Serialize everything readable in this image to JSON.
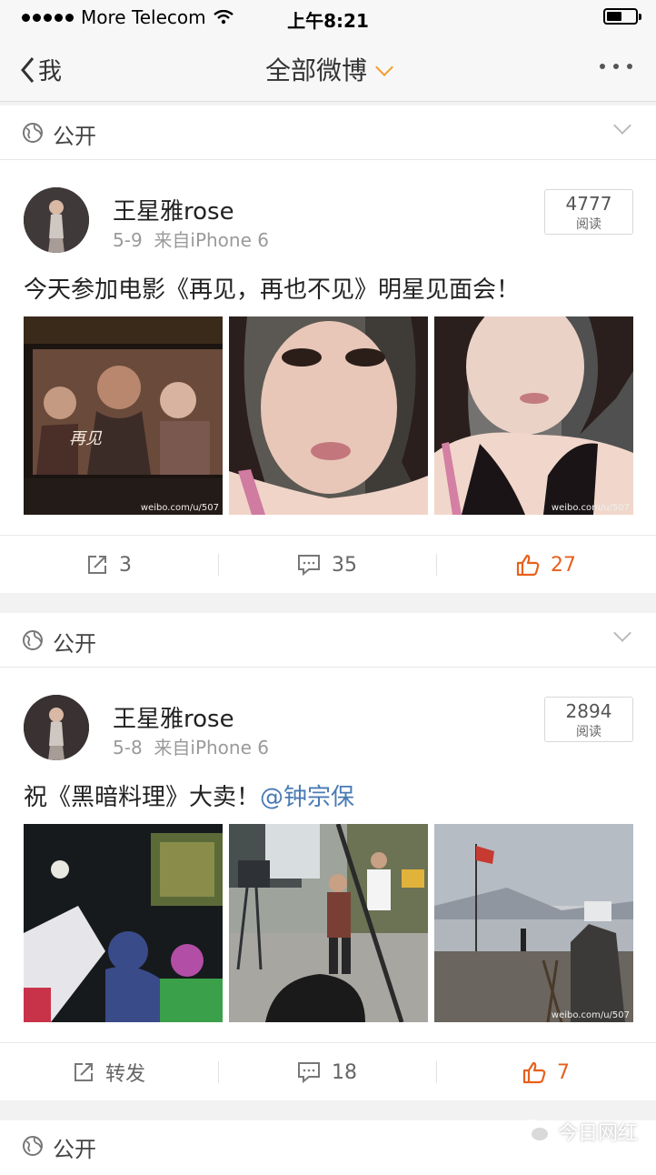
{
  "status_bar": {
    "carrier": "More Telecom",
    "time": "上午8:21"
  },
  "nav": {
    "back_label": "我",
    "title": "全部微博"
  },
  "accent_color": "#f39c2d",
  "like_color": "#e8601c",
  "posts": [
    {
      "visibility": "公开",
      "username": "王星雅rose",
      "date": "5-9",
      "source": "来自iPhone 6",
      "read_count": "4777",
      "read_label": "阅读",
      "text": "今天参加电影《再见，再也不见》明星见面会！",
      "mention": "",
      "photos": [
        "movie-poster-photo",
        "selfie-photo",
        "selfie-photo"
      ],
      "watermark": "weibo.com/u/507",
      "repost": "3",
      "comments": "35",
      "likes": "27"
    },
    {
      "visibility": "公开",
      "username": "王星雅rose",
      "date": "5-8",
      "source": "来自iPhone 6",
      "read_count": "2894",
      "read_label": "阅读",
      "text": "祝《黑暗料理》大卖！",
      "mention": "@钟宗保",
      "photos": [
        "night-set-photo",
        "film-crew-photo",
        "seaside-flag-photo"
      ],
      "watermark": "weibo.com/u/507",
      "repost": "转发",
      "comments": "18",
      "likes": "7"
    }
  ],
  "next_post": {
    "visibility": "公开"
  },
  "brand_watermark": "今日网红"
}
